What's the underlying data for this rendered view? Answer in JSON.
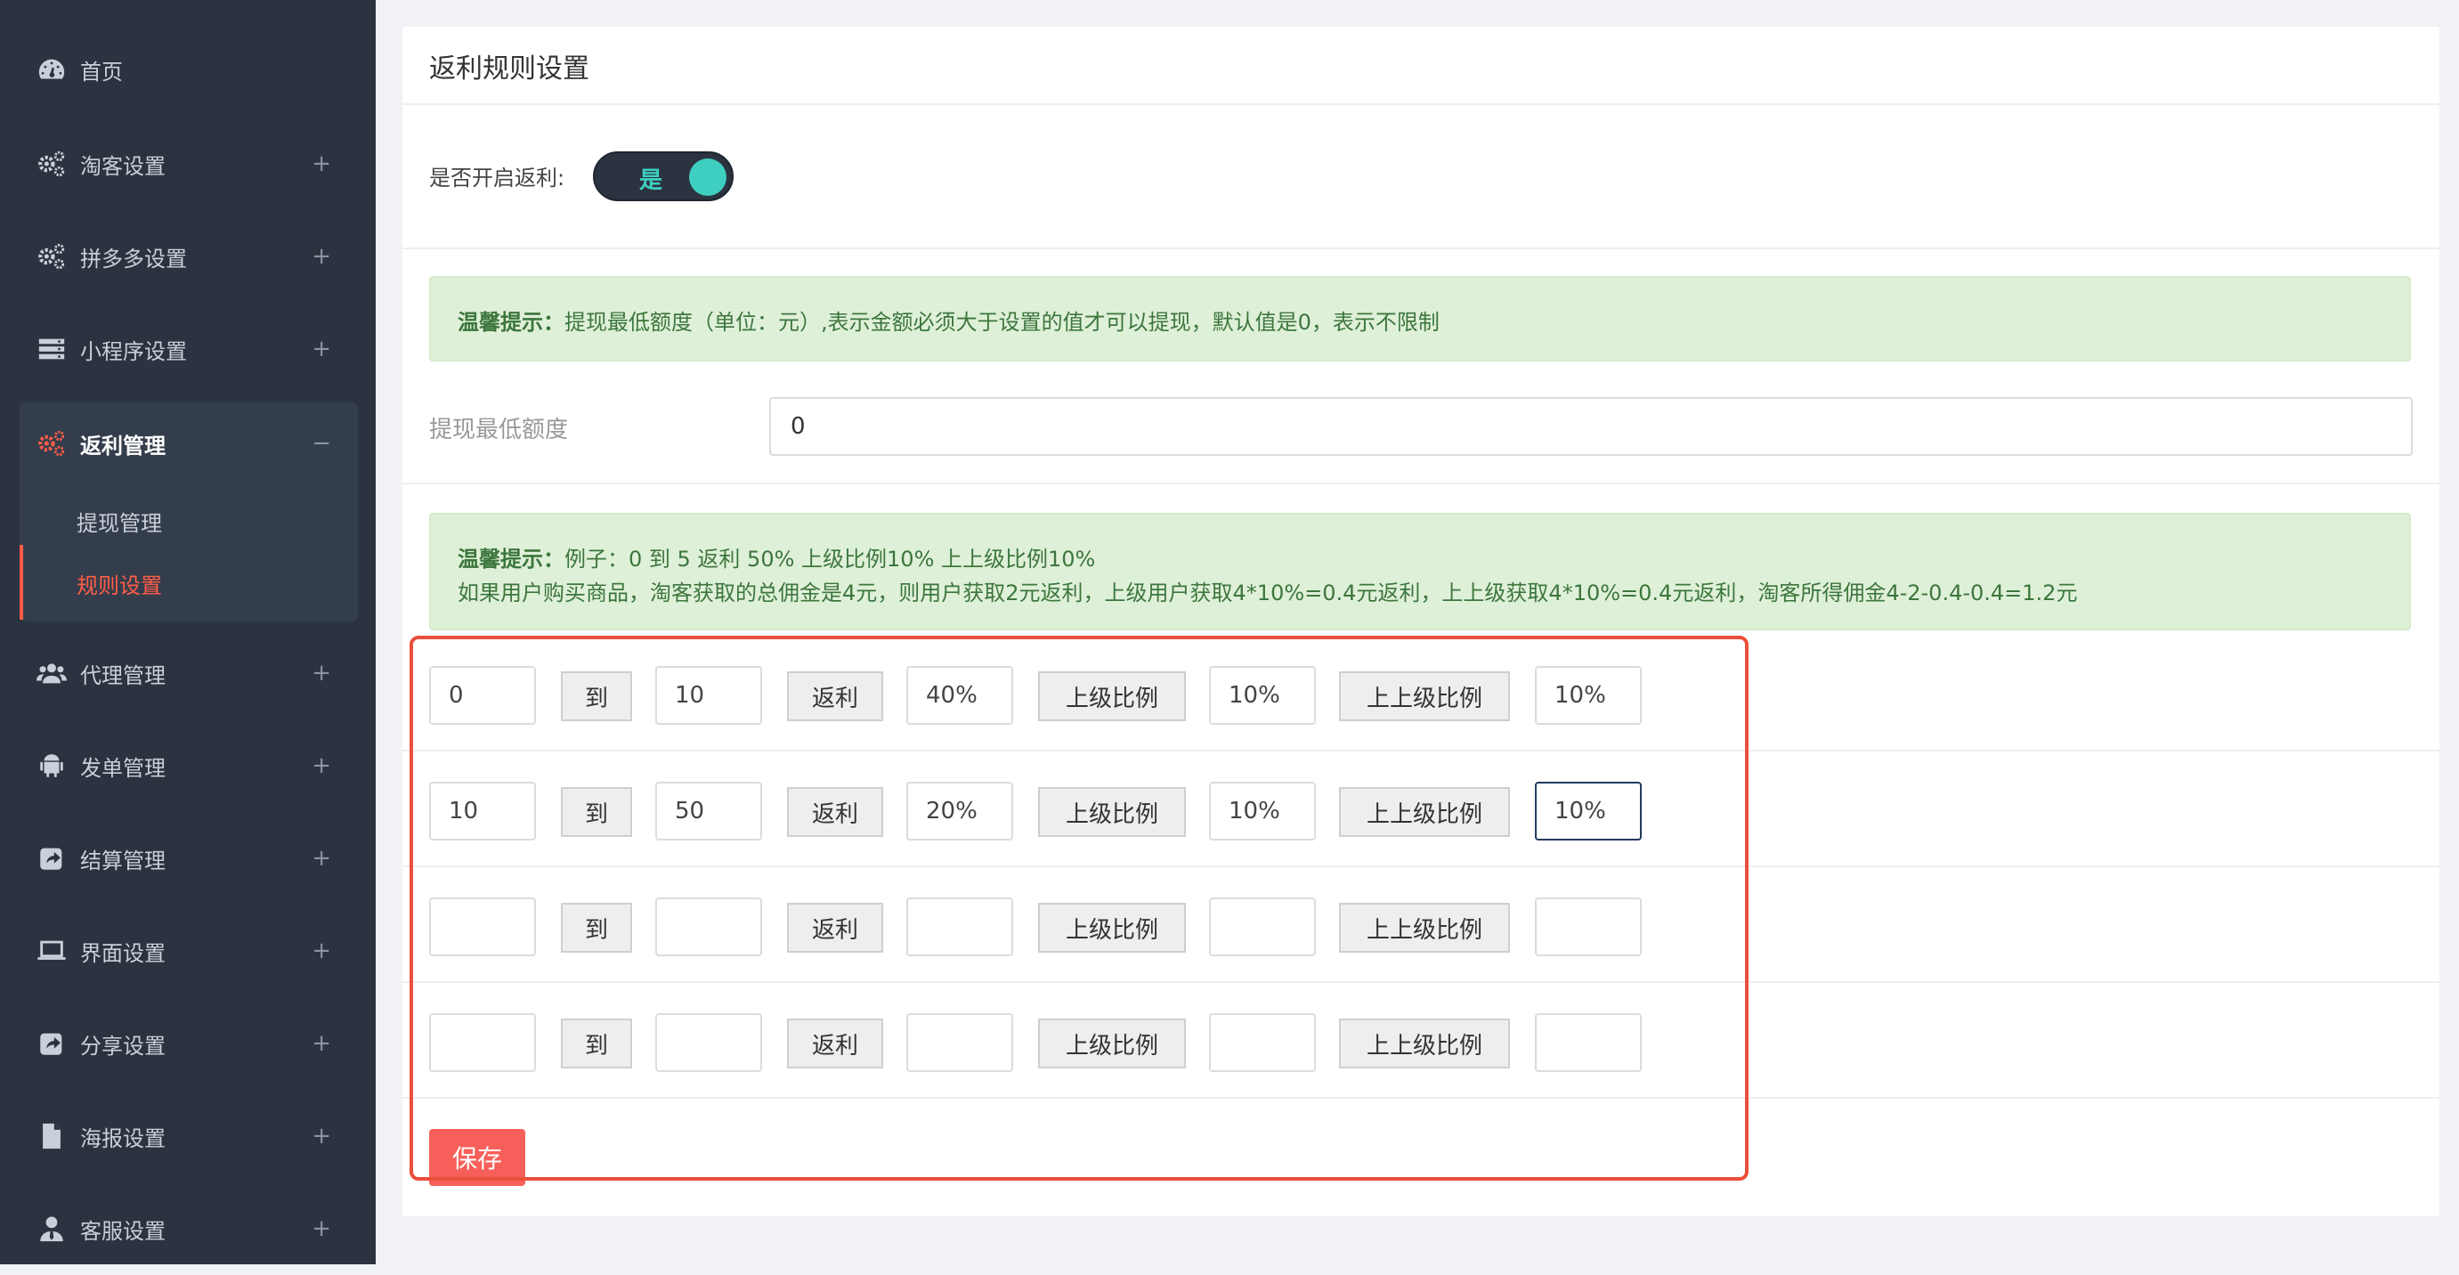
{
  "sidebar": {
    "items": [
      {
        "label": "首页",
        "icon": "dashboard-icon",
        "toggle": ""
      },
      {
        "label": "淘客设置",
        "icon": "cogs-icon",
        "toggle": "+"
      },
      {
        "label": "拼多多设置",
        "icon": "cogs-icon",
        "toggle": "+"
      },
      {
        "label": "小程序设置",
        "icon": "server-icon",
        "toggle": "+"
      },
      {
        "label": "返利管理",
        "icon": "cogs-icon",
        "toggle": "−"
      },
      {
        "label": "代理管理",
        "icon": "users-icon",
        "toggle": "+"
      },
      {
        "label": "发单管理",
        "icon": "android-icon",
        "toggle": "+"
      },
      {
        "label": "结算管理",
        "icon": "share-square-icon",
        "toggle": "+"
      },
      {
        "label": "界面设置",
        "icon": "laptop-icon",
        "toggle": "+"
      },
      {
        "label": "分享设置",
        "icon": "share-icon",
        "toggle": "+"
      },
      {
        "label": "海报设置",
        "icon": "file-icon",
        "toggle": "+"
      },
      {
        "label": "客服设置",
        "icon": "user-tie-icon",
        "toggle": "+"
      }
    ],
    "sub_items": [
      {
        "label": "提现管理"
      },
      {
        "label": "规则设置"
      }
    ]
  },
  "panel": {
    "title": "返利规则设置",
    "switch_label": "是否开启返利:",
    "switch_text": "是",
    "tip1": {
      "prefix": "温馨提示：",
      "text": "提现最低额度（单位：元）,表示金额必须大于设置的值才可以提现，默认值是0，表示不限制"
    },
    "min_withdraw": {
      "label": "提现最低额度",
      "value": "0"
    },
    "tip2": {
      "prefix": "温馨提示：",
      "line1": "例子：0 到 5 返利 50% 上级比例10% 上上级比例10%",
      "line2": "如果用户购买商品，淘客获取的总佣金是4元，则用户获取2元返利，上级用户获取4*10%=0.4元返利，上上级获取4*10%=0.4元返利，淘客所得佣金4-2-0.4-0.4=1.2元"
    },
    "rule_labels": {
      "to": "到",
      "rebate": "返利",
      "parent": "上级比例",
      "grandparent": "上上级比例"
    },
    "rules": [
      {
        "from": "0",
        "to": "10",
        "rebate": "40%",
        "parent": "10%",
        "grandparent": "10%"
      },
      {
        "from": "10",
        "to": "50",
        "rebate": "20%",
        "parent": "10%",
        "grandparent": "10%"
      },
      {
        "from": "",
        "to": "",
        "rebate": "",
        "parent": "",
        "grandparent": ""
      },
      {
        "from": "",
        "to": "",
        "rebate": "",
        "parent": "",
        "grandparent": ""
      }
    ],
    "save_label": "保存"
  },
  "colors": {
    "accent": "#ff5d48",
    "switch_on": "#3ecfc0",
    "highlight": "#ea4f3a",
    "sidebar": "#2b3340"
  }
}
